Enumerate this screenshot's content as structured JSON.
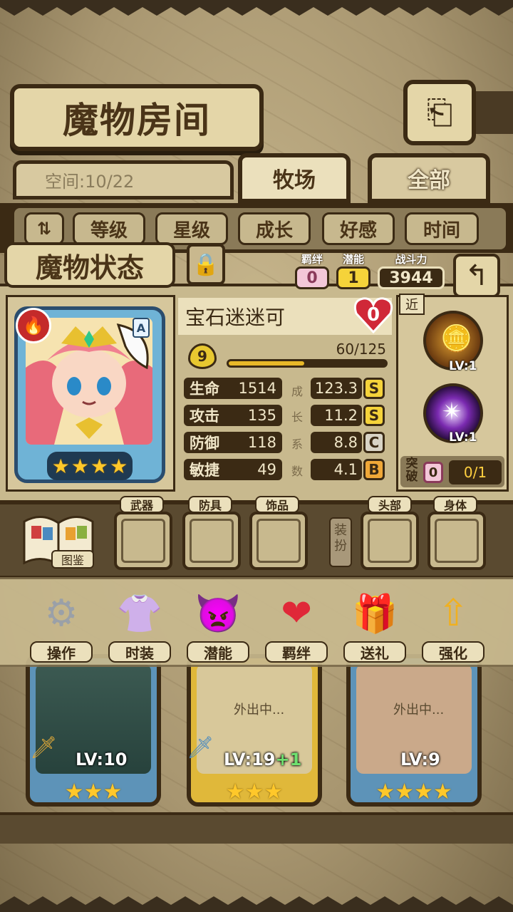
{
  "header": {
    "title": "魔物房间",
    "back_icon": "return-icon"
  },
  "space": {
    "label": "空间:10/22"
  },
  "tabs": [
    {
      "label": "牧场",
      "active": true
    },
    {
      "label": "全部",
      "active": false
    }
  ],
  "sort_buttons": [
    "等级",
    "星级",
    "成长",
    "好感",
    "时间"
  ],
  "status": {
    "title": "魔物状态",
    "bond_label": "羁绊",
    "bond_value": "0",
    "potential_label": "潜能",
    "potential_value": "1",
    "power_label": "战斗力",
    "power_value": "3944"
  },
  "monster": {
    "name": "宝石迷迷可",
    "affection": "0",
    "rank": "A",
    "level": "9",
    "exp": "60/125",
    "exp_fraction": 0.48,
    "stars": 4,
    "element_icon": "fire-icon",
    "stats": [
      {
        "label": "生命",
        "value": "1514",
        "growth": "123.3",
        "grade": "S"
      },
      {
        "label": "攻击",
        "value": "135",
        "growth": "11.2",
        "grade": "S"
      },
      {
        "label": "防御",
        "value": "118",
        "growth": "8.8",
        "grade": "C"
      },
      {
        "label": "敏捷",
        "value": "49",
        "growth": "4.1",
        "grade": "B"
      }
    ],
    "growth_chars": [
      "成",
      "长",
      "系",
      "数"
    ]
  },
  "skills": {
    "range": "近",
    "items": [
      {
        "level": "LV:1"
      },
      {
        "level": "LV:1"
      }
    ],
    "breakthrough_label": "突破",
    "breakthrough_count": "0",
    "breakthrough_progress": "0/1"
  },
  "equipment": {
    "book_label": "图鉴",
    "slots": [
      "武器",
      "防具",
      "饰品",
      "头部",
      "身体"
    ],
    "dress_label": "装扮"
  },
  "actions": [
    "操作",
    "时装",
    "潜能",
    "羁绊",
    "送礼",
    "强化"
  ],
  "roster": [
    {
      "level": "LV:10",
      "stars": 3,
      "away": ""
    },
    {
      "level": "LV:19",
      "bonus": "+1",
      "stars": 3,
      "away": "外出中..."
    },
    {
      "level": "LV:9",
      "stars": 4,
      "away": "外出中..."
    }
  ],
  "colors": {
    "grade_s": "#f5d33a",
    "grade_c": "#d9d4c6",
    "grade_b": "#f0a838",
    "bond": "#f3c7d8",
    "potential": "#f5d33a"
  }
}
